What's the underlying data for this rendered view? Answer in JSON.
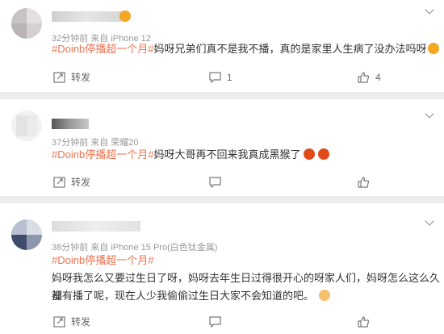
{
  "posts": [
    {
      "meta": "32分钟前  来自 iPhone 12",
      "tag": "#Doinb停播超一个月#",
      "text": "妈呀兄弟们真不是我不播，真的是家里人生病了没办法吗呀",
      "actions": {
        "forward": "转发",
        "comment": "1",
        "like": "4"
      }
    },
    {
      "meta": "37分钟前  来自 荣耀20",
      "tag": "#Doinb停播超一个月#",
      "text": "妈呀大哥再不回来我真成黑猴了",
      "actions": {
        "forward": "转发",
        "comment": "",
        "like": ""
      }
    },
    {
      "meta": "38分钟前  来自 iPhone 15 Pro(白色钛金属)",
      "tag": "#Doinb停播超一个月#",
      "text_line1": "妈呀我怎么又要过生日了呀，妈呀去年生日过得很开心的呀家人们，妈呀怎么这么久都",
      "text_line2": "没有播了呢，现在人少我偷偷过生日大家不会知道的吧。",
      "actions": {
        "forward": "转发",
        "comment": "",
        "like": ""
      }
    }
  ],
  "colors": {
    "tag": "#eb7350",
    "emoji_laugh": "#f5a623",
    "emoji_angry": "#e04a1b"
  }
}
